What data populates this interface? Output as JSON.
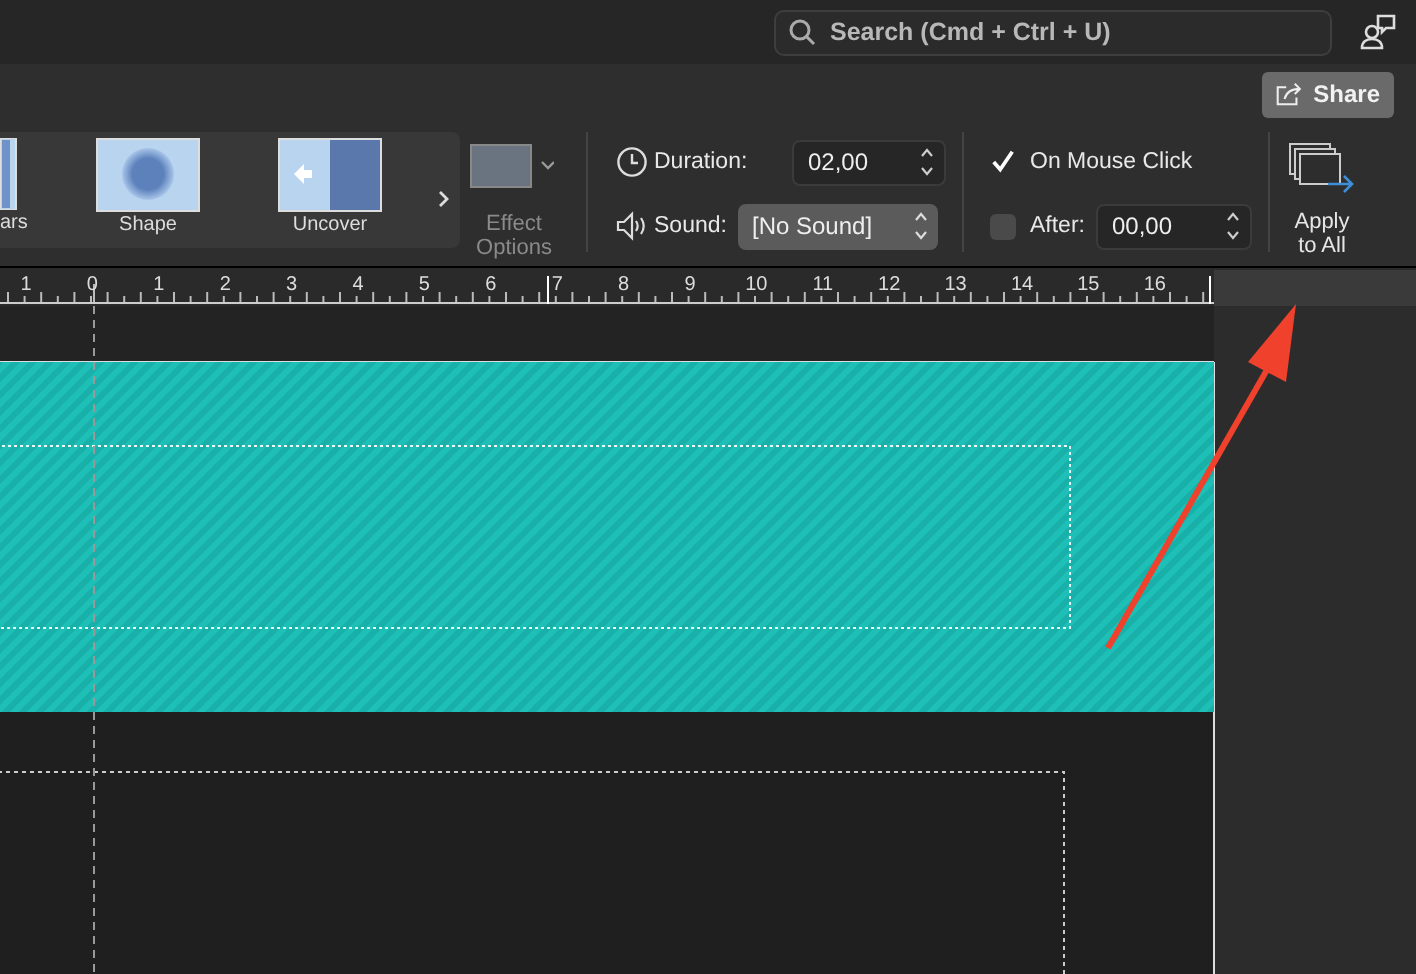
{
  "search": {
    "placeholder": "Search (Cmd + Ctrl + U)"
  },
  "share_button": "Share",
  "transitions": [
    {
      "label": "ars",
      "kind": "bars",
      "selected": false
    },
    {
      "label": "Shape",
      "kind": "shape",
      "selected": false
    },
    {
      "label": "Uncover",
      "kind": "uncover",
      "selected": false
    }
  ],
  "effect_options": "Effect Options",
  "duration": {
    "label": "Duration:",
    "value": "02,00"
  },
  "sound": {
    "label": "Sound:",
    "value": "[No Sound]"
  },
  "on_mouse_click": {
    "label": "On Mouse Click",
    "checked": true
  },
  "after": {
    "label": "After:",
    "checked": false,
    "value": "00,00"
  },
  "apply_to_all": "Apply to All",
  "ruler": {
    "labels": [
      "1",
      "0",
      "1",
      "2",
      "3",
      "4",
      "5",
      "6",
      "7",
      "8",
      "9",
      "10",
      "11",
      "12",
      "13",
      "14",
      "15",
      "16"
    ]
  }
}
